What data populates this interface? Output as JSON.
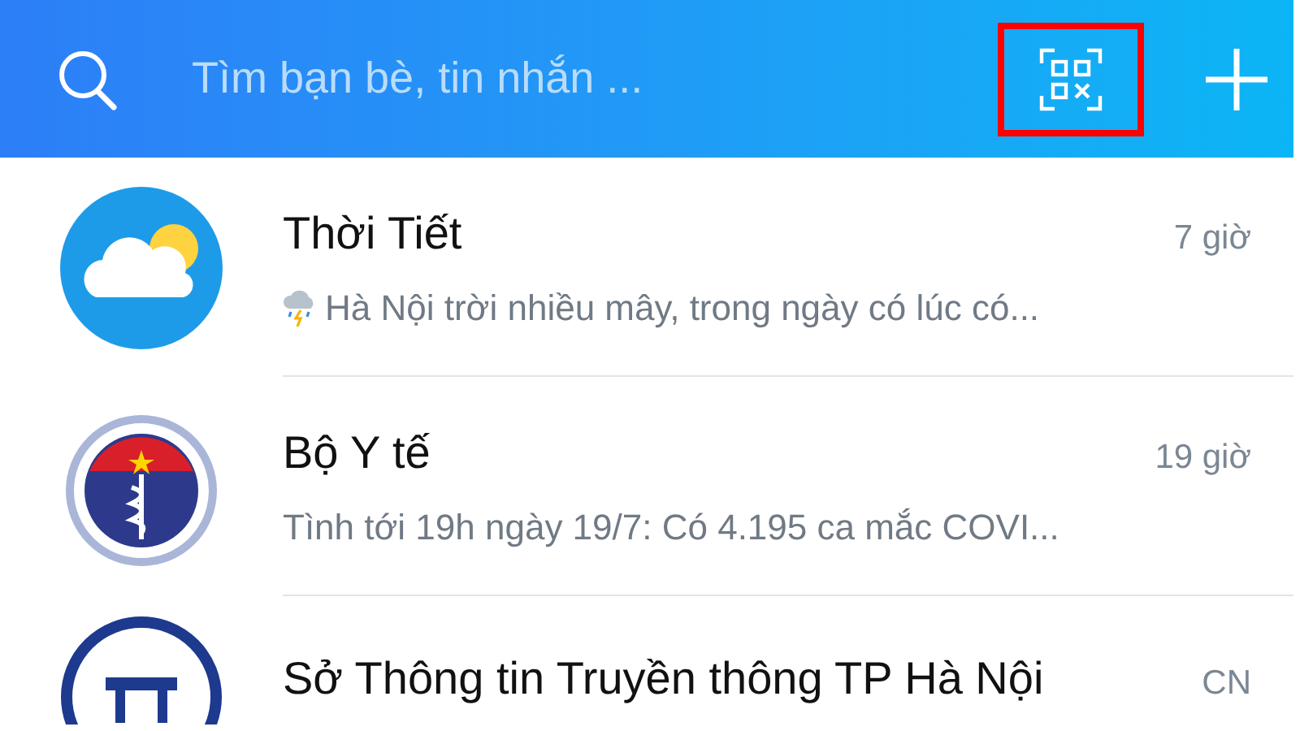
{
  "header": {
    "search": {
      "placeholder": "Tìm bạn bè, tin nhắn ..."
    },
    "qr_button": {
      "highlighted": true
    }
  },
  "conversations": [
    {
      "name": "Thời Tiết",
      "time": "7 giờ",
      "preview": "Hà Nội trời nhiều mây, trong ngày có lúc có...",
      "avatar": {
        "kind": "weather"
      },
      "preview_icon": {
        "kind": "storm"
      }
    },
    {
      "name": "Bộ Y tế",
      "time": "19 giờ",
      "preview": "Tình tới 19h ngày 19/7: Có 4.195 ca mắc COVI...",
      "avatar": {
        "kind": "emblem"
      }
    },
    {
      "name": "Sở Thông tin Truyền thông TP Hà Nội",
      "time": "CN",
      "avatar": {
        "kind": "seal"
      }
    }
  ]
}
